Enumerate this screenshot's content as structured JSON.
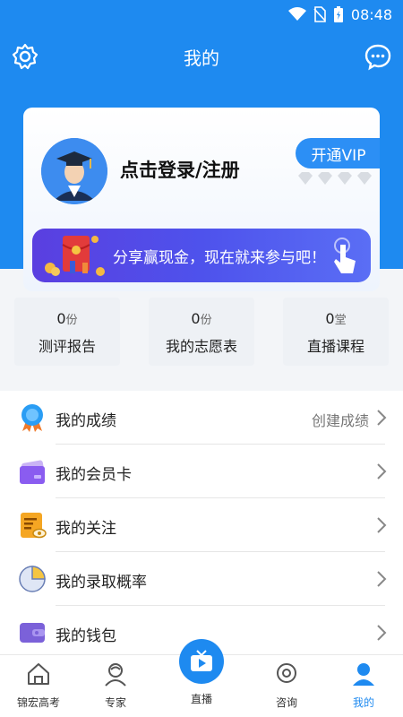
{
  "status_bar": {
    "time": "08:48"
  },
  "header": {
    "title": "我的"
  },
  "profile": {
    "login_text": "点击登录/注册",
    "vip_button": "开通VIP"
  },
  "banner": {
    "text": "分享赢现金，现在就来参与吧！"
  },
  "stats": [
    {
      "value": "0",
      "unit": "份",
      "label": "测评报告"
    },
    {
      "value": "0",
      "unit": "份",
      "label": "我的志愿表"
    },
    {
      "value": "0",
      "unit": "堂",
      "label": "直播课程"
    }
  ],
  "menu": [
    {
      "label": "我的成绩",
      "extra": "创建成绩",
      "icon": "medal-icon"
    },
    {
      "label": "我的会员卡",
      "extra": "",
      "icon": "member-card-icon"
    },
    {
      "label": "我的关注",
      "extra": "",
      "icon": "follow-doc-icon"
    },
    {
      "label": "我的录取概率",
      "extra": "",
      "icon": "pie-chart-icon"
    },
    {
      "label": "我的钱包",
      "extra": "",
      "icon": "wallet-icon"
    }
  ],
  "bottom_nav": [
    {
      "label": "锦宏高考",
      "icon": "home-icon"
    },
    {
      "label": "专家",
      "icon": "expert-icon"
    },
    {
      "label": "直播",
      "icon": "tv-play-icon"
    },
    {
      "label": "咨询",
      "icon": "consult-icon"
    },
    {
      "label": "我的",
      "icon": "profile-icon"
    }
  ],
  "colors": {
    "primary": "#1e8af0",
    "banner_start": "#5a3fe0",
    "banner_end": "#5a6ef5"
  }
}
